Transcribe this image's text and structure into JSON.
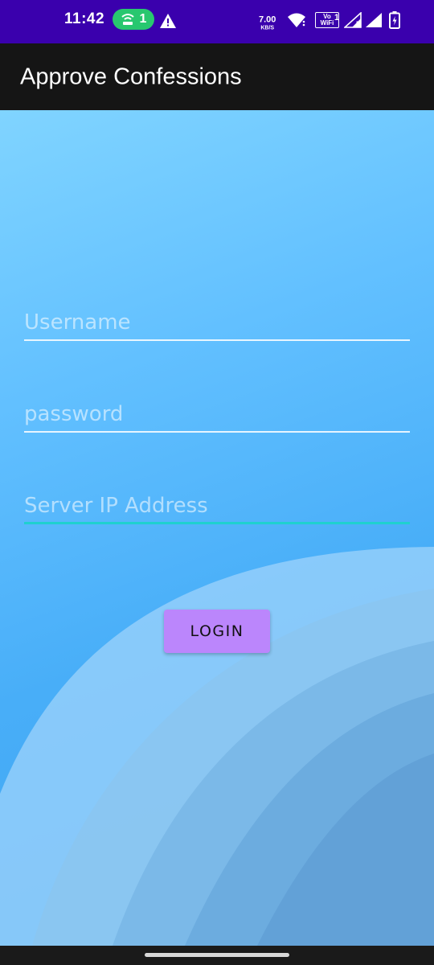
{
  "status_bar": {
    "time": "11:42",
    "hotspot_count": "1",
    "net_speed_value": "7.00",
    "net_speed_unit": "KB/S",
    "volte_label": "Vo WiFi",
    "volte_sub": "1",
    "roaming_label": "R",
    "icons": [
      "wifi-hotspot-icon",
      "warning-icon",
      "wifi-icon",
      "vowifi-icon",
      "signal-icon",
      "signal-roaming-icon",
      "battery-charging-icon"
    ]
  },
  "app_bar": {
    "title": "Approve Confessions"
  },
  "form": {
    "username_placeholder": "Username",
    "username_value": "",
    "password_placeholder": "password",
    "password_value": "",
    "server_placeholder": "Server IP Address",
    "server_value": "",
    "login_label": "LOGIN"
  },
  "colors": {
    "status_bar": "#3a00ad",
    "app_bar": "#151515",
    "accent_underline": "#1fd1cf",
    "login_button": "#bb86fc",
    "hotspot_pill": "#28c76f"
  }
}
